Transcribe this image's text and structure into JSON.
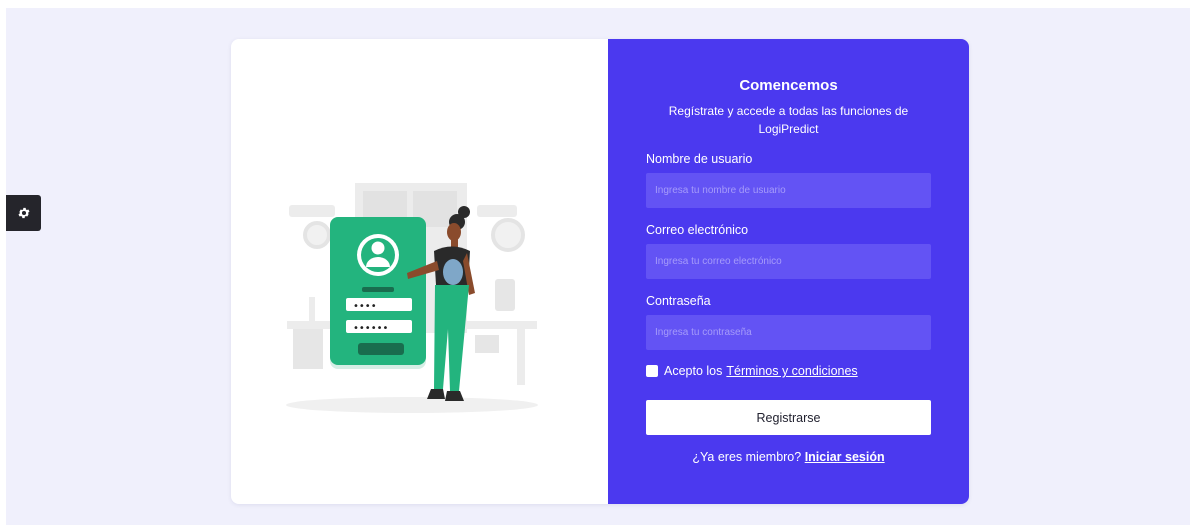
{
  "form": {
    "title": "Comencemos",
    "subtitle": "Regístrate y accede a todas las funciones de LogiPredict",
    "username": {
      "label": "Nombre de usuario",
      "placeholder": "Ingresa tu nombre de usuario",
      "value": ""
    },
    "email": {
      "label": "Correo electrónico",
      "placeholder": "Ingresa tu correo electrónico",
      "value": ""
    },
    "password": {
      "label": "Contraseña",
      "placeholder": "Ingresa tu contraseña",
      "value": ""
    },
    "terms_prefix": "Acepto los",
    "terms_link": "Términos y condiciones",
    "terms_checked": false,
    "submit_label": "Registrarse",
    "member_prompt": "¿Ya eres miembro?",
    "login_link": "Iniciar sesión"
  },
  "illustration": {
    "password_masked_1": "••••",
    "password_masked_2": "••••••"
  },
  "icons": {
    "settings": "gear-icon"
  },
  "colors": {
    "page_background": "#f0f0fc",
    "accent": "#4b39ef",
    "input_background": "#6353f4",
    "illustration_green": "#23b47e",
    "settings_button": "#25252b"
  }
}
